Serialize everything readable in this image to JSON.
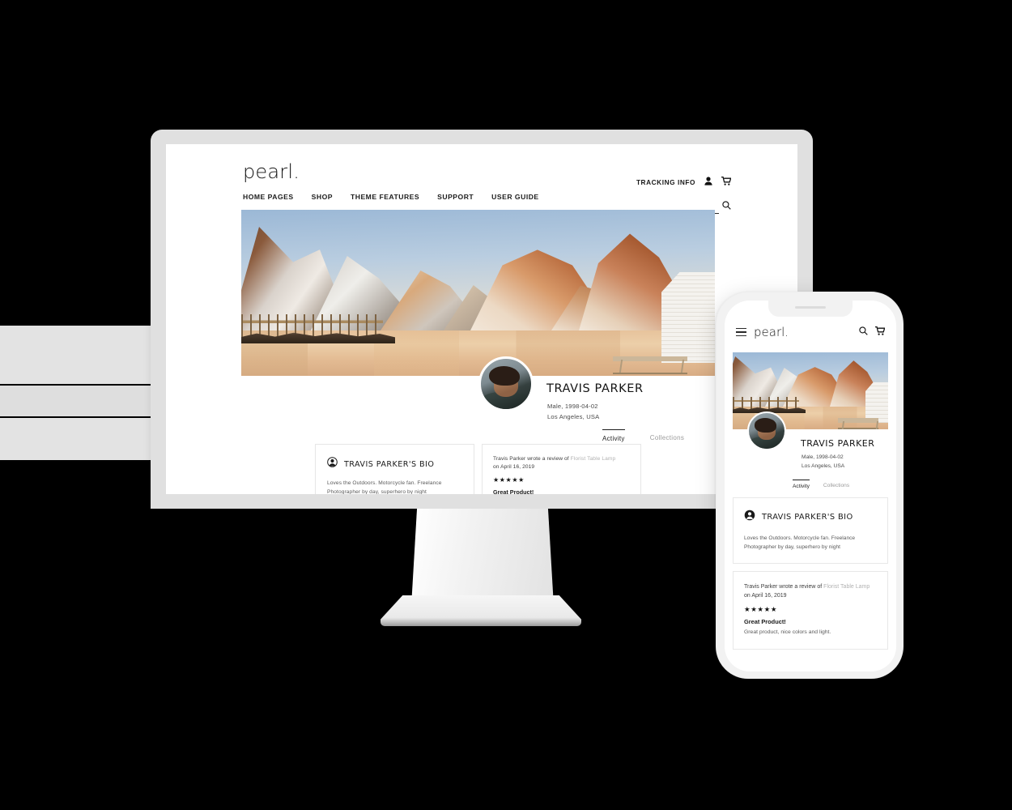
{
  "site": {
    "logo": "pearl.",
    "tracking_label": "TRACKING INFO",
    "nav": [
      {
        "label": "HOME PAGES"
      },
      {
        "label": "SHOP"
      },
      {
        "label": "THEME FEATURES"
      },
      {
        "label": "SUPPORT"
      },
      {
        "label": "USER GUIDE"
      }
    ],
    "search_placeholder": "",
    "search_value": "",
    "icons": {
      "user": "user-icon",
      "cart": "cart-icon",
      "search": "search-icon",
      "menu": "hamburger-menu-icon",
      "bio": "person-circle-icon"
    }
  },
  "profile": {
    "name": "TRAVIS PARKER",
    "meta_line1": "Male, 1998-04-02",
    "meta_line2": "Los Angeles, USA",
    "tabs": [
      {
        "label": "Activity",
        "active": true
      },
      {
        "label": "Collections",
        "active": false
      }
    ]
  },
  "bio_card": {
    "title": "TRAVIS PARKER'S BIO",
    "text": "Loves the Outdoors. Motorcycle fan. Freelance Photographer by day, superhero by night"
  },
  "review_card": {
    "intro": "Travis Parker wrote a review of",
    "product": "Florist Table Lamp",
    "date_line": "on April 16, 2019",
    "stars": "★★★★★",
    "rating": 5,
    "headline": "Great Product!",
    "body": "Great product, nice colors and light."
  },
  "colors": {
    "page_background": "#000000",
    "device_frame": "#e0e0e0",
    "screen": "#ffffff",
    "text_primary": "#1a1a1a",
    "text_muted": "#5a5a5a",
    "link_muted": "#b2b2b2",
    "card_border": "#e6e6e6",
    "band": "#e3e3e3"
  }
}
